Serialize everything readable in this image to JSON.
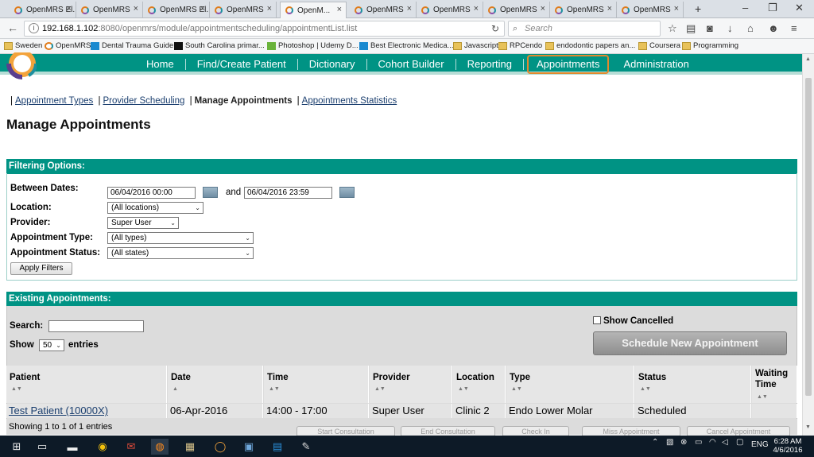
{
  "browser": {
    "tabs": [
      {
        "label": "OpenMRS El...",
        "active": false
      },
      {
        "label": "OpenMRS",
        "active": false
      },
      {
        "label": "OpenMRS El...",
        "active": false
      },
      {
        "label": "OpenMRS",
        "active": false
      },
      {
        "label": "OpenM...",
        "active": true
      },
      {
        "label": "OpenMRS",
        "active": false
      },
      {
        "label": "OpenMRS",
        "active": false
      },
      {
        "label": "OpenMRS",
        "active": false
      },
      {
        "label": "OpenMRS",
        "active": false
      },
      {
        "label": "OpenMRS",
        "active": false
      }
    ],
    "url_host": "192.168.1.102",
    "url_path": ":8080/openmrs/module/appointmentscheduling/appointmentList.list",
    "search_placeholder": "Search",
    "bookmarks": [
      "Sweden",
      "OpenMRS",
      "Dental Trauma Guide",
      "South Carolina primar...",
      "Photoshop | Udemy D...",
      "Best Electronic Medica...",
      "Javascript",
      "RPCendo",
      "endodontic papers an...",
      "Coursera",
      "Programming"
    ]
  },
  "app": {
    "nav": [
      "Home",
      "Find/Create Patient",
      "Dictionary",
      "Cohort Builder",
      "Reporting",
      "Appointments",
      "Administration"
    ],
    "active_nav": "Appointments",
    "accent_color": "#009384",
    "highlight_color": "#e2892d"
  },
  "subnav": {
    "links": [
      "Appointment Types",
      "Provider Scheduling",
      "Manage Appointments",
      "Appointments Statistics"
    ],
    "current": "Manage Appointments"
  },
  "page_title": "Manage Appointments",
  "filters": {
    "header": "Filtering Options:",
    "between_label": "Between Dates:",
    "start_date": "06/04/2016 00:00",
    "and_label": "and",
    "end_date": "06/04/2016 23:59",
    "location_label": "Location:",
    "location_value": "(All locations)",
    "provider_label": "Provider:",
    "provider_value": "Super User",
    "type_label": "Appointment Type:",
    "type_value": "(All types)",
    "status_label": "Appointment Status:",
    "status_value": "(All states)",
    "apply_label": "Apply Filters"
  },
  "appointments": {
    "header": "Existing Appointments:",
    "search_label": "Search:",
    "show_label": "Show",
    "show_value": "50",
    "entries_label": "entries",
    "show_cancelled_label": "Show Cancelled",
    "schedule_button": "Schedule New Appointment",
    "columns": [
      "Patient",
      "Date",
      "Time",
      "Provider",
      "Location",
      "Type",
      "Status",
      "Waiting Time"
    ],
    "rows": [
      {
        "patient": "Test Patient (10000X)",
        "date": "06-Apr-2016",
        "time": "14:00 - 17:00",
        "provider": "Super User",
        "location": "Clinic 2",
        "type": "Endo Lower Molar",
        "status": "Scheduled",
        "waiting": ""
      }
    ],
    "info": "Showing 1 to 1 of 1 entries",
    "action_buttons": [
      "Start Consultation",
      "End Consultation",
      "Check In",
      "Miss Appointment",
      "Cancel Appointment"
    ]
  },
  "taskbar": {
    "time": "6:28 AM",
    "date": "4/6/2016",
    "lang": "ENG"
  }
}
